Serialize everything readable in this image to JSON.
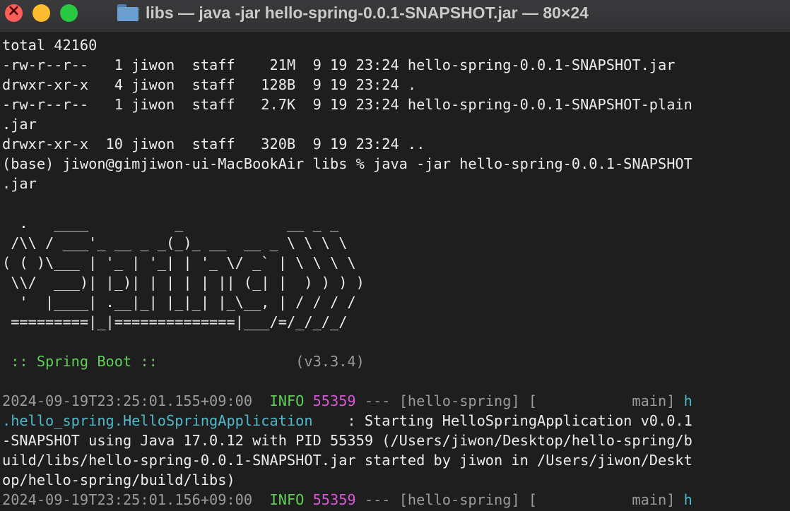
{
  "window": {
    "title": "libs — java -jar hello-spring-0.0.1-SNAPSHOT.jar — 80×24",
    "folder_icon": "folder-icon"
  },
  "colors": {
    "background": "#1e1e1e",
    "text": "#ececec",
    "timestamp": "#9b9b9b",
    "info": "#5fcf55",
    "pid": "#d957d9",
    "logger": "#4fb8c8"
  },
  "terminal": {
    "listing": [
      "total 42160",
      "-rw-r--r--   1 jiwon  staff    21M  9 19 23:24 hello-spring-0.0.1-SNAPSHOT.jar",
      "drwxr-xr-x   4 jiwon  staff   128B  9 19 23:24 .",
      "-rw-r--r--   1 jiwon  staff   2.7K  9 19 23:24 hello-spring-0.0.1-SNAPSHOT-plain",
      ".jar",
      "drwxr-xr-x  10 jiwon  staff   320B  9 19 23:24 .."
    ],
    "prompt": {
      "text": "(base) jiwon@gimjiwon-ui-MacBookAir libs % java -jar hello-spring-0.0.1-SNAPSHOT",
      "wrap": ".jar"
    },
    "banner": [
      "  .   ____          _            __ _ _",
      " /\\\\ / ___'_ __ _ _(_)_ __  __ _ \\ \\ \\ \\",
      "( ( )\\___ | '_ | '_| | '_ \\/ _` | \\ \\ \\ \\",
      " \\\\/  ___)| |_)| | | | | || (_| |  ) ) ) )",
      "  '  |____| .__|_| |_|_| |_\\__, | / / / /",
      " =========|_|==============|___/=/_/_/_/"
    ],
    "boot": {
      "label": " :: Spring Boot :: ",
      "spacer": "              ",
      "version": " (v3.3.4)"
    },
    "log1": {
      "timestamp": "2024-09-19T23:25:01.155+09:00",
      "level": "INFO",
      "pid": "55359",
      "thread": "--- [hello-spring] [           main] ",
      "logger_start": "h",
      "logger_rest": ".hello_spring.HelloSpringApplication",
      "separator": "    : ",
      "message_1": "Starting HelloSpringApplication v0.0.1",
      "message_2": "-SNAPSHOT using Java 17.0.12 with PID 55359 (/Users/jiwon/Desktop/hello-spring/b",
      "message_3": "uild/libs/hello-spring-0.0.1-SNAPSHOT.jar started by jiwon in /Users/jiwon/Deskt",
      "message_4": "op/hello-spring/build/libs)"
    },
    "log2": {
      "timestamp": "2024-09-19T23:25:01.156+09:00",
      "level": "INFO",
      "pid": "55359",
      "thread": "--- [hello-spring] [           main] ",
      "logger_start": "h"
    }
  }
}
